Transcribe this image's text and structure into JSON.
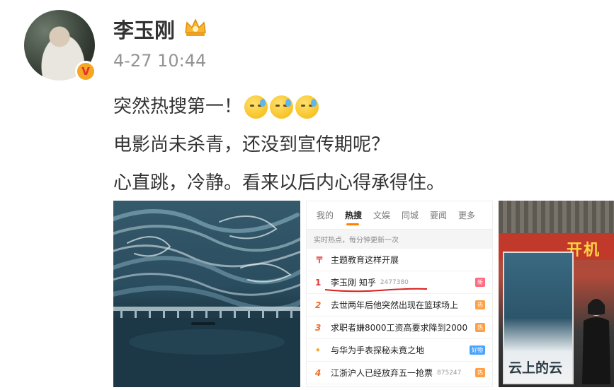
{
  "user": {
    "name": "李玉刚",
    "timestamp": "4-27 10:44",
    "verified_badge": "V",
    "crown_badge": "crown-icon"
  },
  "post": {
    "lines": [
      "突然热搜第一！",
      "电影尚未杀青，还没到宣传期呢？",
      "心直跳，冷静。看来以后内心得承得住。"
    ],
    "emoji": "sweat-emoji"
  },
  "screenshot": {
    "tabs": [
      "我的",
      "热搜",
      "文娱",
      "同城",
      "要闻",
      "更多"
    ],
    "active_tab": "热搜",
    "subtitle": "实时热点，每分钟更新一次",
    "items": [
      {
        "rank": "",
        "rank_symbol": "top",
        "title": "主题教育这样开展",
        "count": "",
        "tag": ""
      },
      {
        "rank": "1",
        "title": "李玉刚 知乎",
        "count": "2477380",
        "tag": "新"
      },
      {
        "rank": "2",
        "title": "去世两年后他突然出现在篮球场上",
        "count": "",
        "tag": "热"
      },
      {
        "rank": "3",
        "title": "求职者嫌8000工资高要求降到2000",
        "count": "",
        "tag": "热"
      },
      {
        "rank": "•",
        "rank_symbol": "dot",
        "title": "与华为手表探秘未竟之地",
        "count": "",
        "tag": "好物"
      },
      {
        "rank": "4",
        "title": "江浙沪人已经放弃五一抢票",
        "count": "875247",
        "tag": "热"
      }
    ]
  },
  "photo3": {
    "banner": "开机",
    "poster_title": "云上的云"
  },
  "colors": {
    "accent": "#ff8200",
    "rank_red": "#e23636",
    "timestamp_gray": "#939393"
  }
}
